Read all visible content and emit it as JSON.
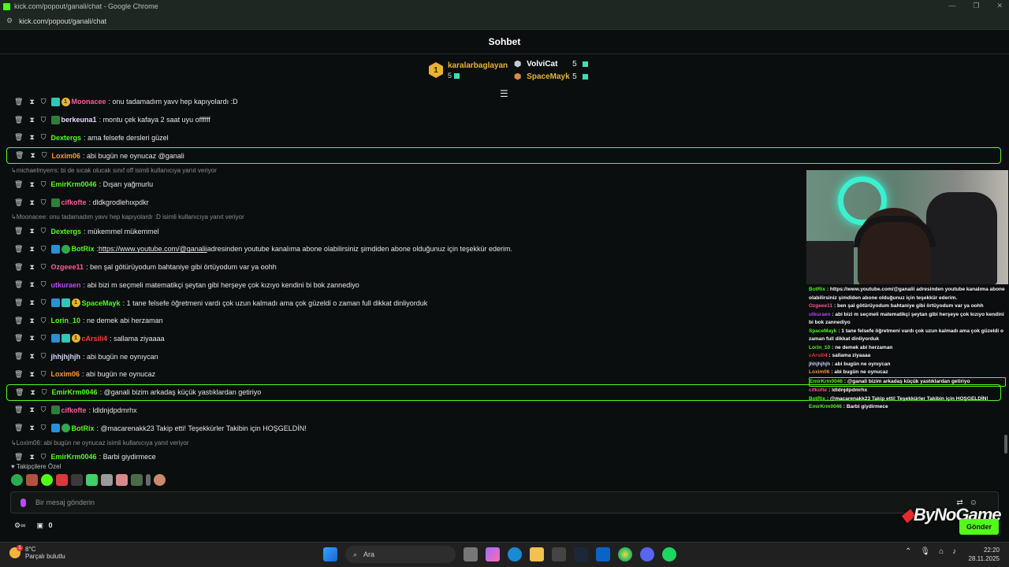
{
  "window": {
    "title": "kick.com/popout/ganali/chat - Google Chrome",
    "url": "kick.com/popout/ganali/chat"
  },
  "header": {
    "title": "Sohbet"
  },
  "leaderboard": [
    {
      "rank": "1",
      "name": "karalarbaglayan",
      "count": "5"
    },
    {
      "name": "VolviCat",
      "count": "5"
    },
    {
      "name": "SpaceMayk",
      "count": "5"
    }
  ],
  "messages": [
    {
      "user": "Moonacee",
      "color": "#ff5a9a",
      "text": ": onu tadamadım yavv hep kapıyolardı :D",
      "badges": [
        "teal",
        "gold"
      ]
    },
    {
      "user": "berkeuna1",
      "color": "#e3d9ff",
      "text": ": montu çek kafaya 2 saat uyu offffff",
      "badges": [
        "leaf"
      ]
    },
    {
      "user": "Dextergs",
      "color": "#53fc18",
      "text": ": ama felsefe dersleri güzel",
      "badges": []
    },
    {
      "user": "Loxim06",
      "color": "#ff9a2e",
      "text": ": abi bugün ne oynucaz @ganali",
      "badges": [],
      "highlight": true
    },
    {
      "reply": "michaelmyerrs: bi de sıcak olucak sınıf off isimli kullanıcıya yanıt veriyor"
    },
    {
      "user": "EmirKrm0046",
      "color": "#53fc18",
      "text": ": Dışarı yağmurlu",
      "badges": []
    },
    {
      "user": "cifkofte",
      "color": "#ff5a9a",
      "text": ": dldkgrodlehıxpdkr",
      "badges": [
        "leaf"
      ]
    },
    {
      "reply": "Moonacee: onu tadamadım yavv hep kapıyolardı :D isimli kullanıcıya yanıt veriyor"
    },
    {
      "user": "Dextergs",
      "color": "#53fc18",
      "text": ": mükemmel mükemmel",
      "badges": []
    },
    {
      "user": "BotRix",
      "color": "#53fc18",
      "link": "https://www.youtube.com/@ganalii",
      "text": " adresinden youtube kanalıma abone olabilirsiniz şimdiden abone olduğunuz için teşekkür ederim.",
      "badges": [
        "blue",
        "green"
      ]
    },
    {
      "user": "Ozgeee11",
      "color": "#ff5a9a",
      "text": ": ben şal götürüyodum bahtaniye gibi örtüyodum var ya oohh",
      "badges": []
    },
    {
      "user": "utkuraen",
      "color": "#b44bff",
      "text": ": abi bizi m seçmeli matematikçi şeytan gibi herşeye çok kızıyo kendini bi bok zannediyo",
      "badges": []
    },
    {
      "user": "SpaceMayk",
      "color": "#53fc18",
      "text": ": 1 tane felsefe öğretmeni vardı çok uzun kalmadı ama çok güzeldi o zaman full dikkat dinliyorduk",
      "badges": [
        "blue",
        "teal",
        "gold"
      ]
    },
    {
      "user": "Lorin_10",
      "color": "#53fc18",
      "text": ": ne demek abi herzaman",
      "badges": []
    },
    {
      "user": "cArsili4",
      "color": "#ff3b3b",
      "text": ": sallama ziyaaaa",
      "badges": [
        "blue",
        "teal",
        "gold"
      ]
    },
    {
      "user": "jhhjhjhjh",
      "color": "#cfd6ff",
      "text": ": abi bugün ne oynıycan",
      "badges": []
    },
    {
      "user": "Loxim06",
      "color": "#ff9a2e",
      "text": ": abi bugün ne oynucaz",
      "badges": []
    },
    {
      "user": "EmirKrm0046",
      "color": "#53fc18",
      "text": ": @ganali bizim arkadaş küçük yastıklardan getiriyo",
      "badges": [],
      "highlight": true
    },
    {
      "user": "cifkofte",
      "color": "#ff5a9a",
      "text": ": ldldnjdpdmrhx",
      "badges": [
        "leaf"
      ]
    },
    {
      "user": "BotRix",
      "color": "#53fc18",
      "text": ": @macarenakk23 Takip etti! Teşekkürler Takibin için HOŞGELDİN!",
      "badges": [
        "blue",
        "green"
      ]
    },
    {
      "reply": "Loxim06: abi bugün ne oynucaz isimli kullanıcıya yanıt veriyor"
    },
    {
      "user": "EmirKrm0046",
      "color": "#53fc18",
      "text": ": Barbi giydirmece",
      "badges": []
    }
  ],
  "footer": {
    "follower_label": "Takipçilere Özel",
    "input_placeholder": "Bir mesaj gönderin",
    "points": "0",
    "send_label": "Gönder"
  },
  "overlay": {
    "brand": "ByNoGame",
    "lines": [
      {
        "user": "BotRix",
        "color": "#53fc18",
        "text": ": https://www.youtube.com/@ganalii adresinden youtube kanalıma abone olabilirsiniz şimdiden abone olduğunuz için teşekkür ederim."
      },
      {
        "user": "Ozgeee11",
        "color": "#ff5a9a",
        "text": ": ben şal götürüyodum bahtaniye gibi örtüyodum var ya oohh"
      },
      {
        "user": "utkuraen",
        "color": "#b44bff",
        "text": ": abi bizi m seçmeli matematikçi şeytan gibi herşeye çok kızıyo kendini bi bok zannediyo"
      },
      {
        "user": "SpaceMayk",
        "color": "#53fc18",
        "text": ": 1 tane felsefe öğretmeni vardı çok uzun kalmadı ama çok güzeldi o zaman full dikkat dinliyorduk"
      },
      {
        "user": "Lorin_10",
        "color": "#53fc18",
        "text": ": ne demek abi herzaman"
      },
      {
        "user": "cArsili4",
        "color": "#ff3b3b",
        "text": ": sallama ziyaaaa"
      },
      {
        "user": "jhhjhjhjh",
        "color": "#cfd6ff",
        "text": ": abi bugün ne oynıycan"
      },
      {
        "user": "Loxim06",
        "color": "#ff9a2e",
        "text": ": abi bugün ne oynucaz"
      },
      {
        "user": "EmirKrm0046",
        "color": "#53fc18",
        "text": ": @ganali bizim arkadaş küçük yastıklardan getiriyo",
        "highlight": true
      },
      {
        "user": "cifkofte",
        "color": "#ff5a9a",
        "text": ": ldldnjdpdmrhx"
      },
      {
        "user": "BotRix",
        "color": "#53fc18",
        "text": ": @macarenakk23 Takip etti! Teşekkürler Takibin için HOŞGELDİN!"
      },
      {
        "user": "EmirKrm0046",
        "color": "#53fc18",
        "text": ": Barbi giydirmece"
      }
    ]
  },
  "taskbar": {
    "weather_temp": "8°C",
    "weather_desc": "Parçalı bulutlu",
    "weather_badge": "1",
    "search_label": "Ara",
    "time": "22:20",
    "date": "28.11.2025"
  }
}
